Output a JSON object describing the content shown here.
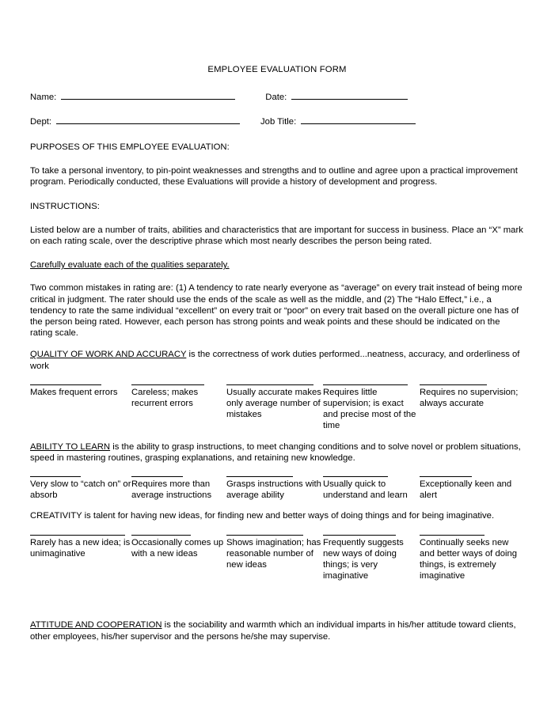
{
  "document": {
    "title": "EMPLOYEE EVALUATION FORM"
  },
  "fields": {
    "name_label": "Name:",
    "name_value": "",
    "date_label": "Date:",
    "date_value": "",
    "dept_label": "Dept:",
    "dept_value": "",
    "job_title_label": "Job Title:",
    "job_title_value": ""
  },
  "purposes": {
    "heading": "PURPOSES OF THIS EMPLOYEE EVALUATION:",
    "body": "To take a personal inventory, to pin-point weaknesses and strengths and to outline and agree upon a practical improvement program.  Periodically conducted, these Evaluations will provide a history of development and progress."
  },
  "instructions": {
    "heading": "INSTRUCTIONS:",
    "body": "Listed below are a number of traits, abilities and characteristics that are important for success in business.  Place an “X” mark on each rating scale, over the descriptive phrase which most nearly describes the person being rated.",
    "emphasis": "Carefully evaluate each of the qualities separately.",
    "mistakes": "Two common mistakes in rating are:  (1) A tendency to rate nearly everyone as “average” on every trait instead of being more critical in judgment.  The rater should use the ends of the scale as well as the middle, and (2) The “Halo Effect,” i.e., a tendency to rate the same individual “excellent” on every trait or “poor” on every trait based on the overall picture one has of the person being rated.  However, each person has strong points and weak points and these should be indicated on the rating scale."
  },
  "traits": [
    {
      "id": "quality-of-work-and-accuracy",
      "title": "QUALITY OF WORK AND ACCURACY",
      "title_underlined": true,
      "description": " is the correctness of work duties performed...neatness, accuracy, and orderliness of work",
      "ratings": [
        "Makes frequent errors",
        "Careless; makes recurrent errors",
        "Usually accurate makes only average number of mistakes",
        "Requires little supervision; is exact and precise most of the time",
        "Requires no supervision; always accurate"
      ]
    },
    {
      "id": "ability-to-learn",
      "title": "ABILITY TO LEARN",
      "title_underlined": true,
      "description": " is the ability to grasp instructions, to meet changing conditions and to solve novel or problem situations, speed in mastering routines, grasping explanations, and retaining new knowledge.",
      "ratings": [
        "Very slow to “catch on” or absorb",
        "Requires more than average instructions",
        "Grasps instructions with average ability",
        "Usually quick to understand and learn",
        "Exceptionally keen and alert"
      ]
    },
    {
      "id": "creativity",
      "title": "CREATIVITY",
      "title_underlined": false,
      "description": " is talent for having new ideas, for finding new and better ways of doing things and for being imaginative.",
      "ratings": [
        "Rarely has a new idea; is unimaginative",
        "Occasionally comes up with a new ideas",
        "Shows imagination; has reasonable number of new ideas",
        "Frequently suggests new ways of doing things; is very imaginative",
        "Continually seeks new and better ways of doing things, is extremely imaginative"
      ]
    },
    {
      "id": "attitude-and-cooperation",
      "title": "ATTITUDE AND COOPERATION",
      "title_underlined": true,
      "description": " is the sociability and warmth which an individual imparts in his/her attitude toward clients, other employees, his/her supervisor and the persons he/she may supervise.",
      "ratings": []
    }
  ]
}
